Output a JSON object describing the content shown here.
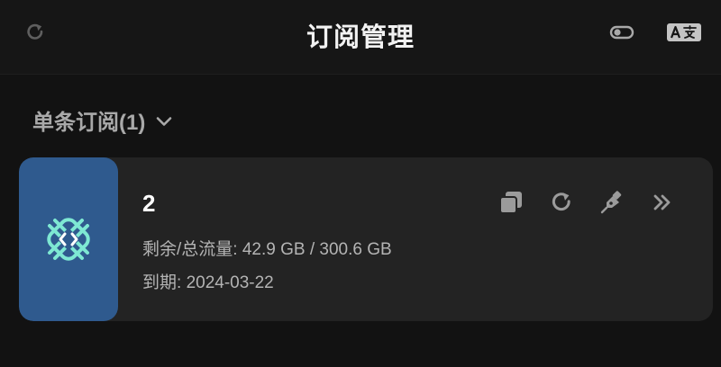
{
  "header": {
    "title": "订阅管理",
    "refresh_icon": "refresh-icon",
    "toggle_icon": "toggle-icon",
    "translate_icon": "translate-icon"
  },
  "group": {
    "title": "单条订阅(1)",
    "expand_icon": "chevron-down-icon"
  },
  "subscriptions": [
    {
      "name": "2",
      "traffic_label": "剩余/总流量:",
      "traffic_value": "42.9 GB / 300.6 GB",
      "expiry_label": "到期:",
      "expiry_value": "2024-03-22",
      "logo_icon": "node-logo-icon",
      "actions": [
        "copy-icon",
        "refresh-icon",
        "edit-pen-icon",
        "more-icon"
      ]
    }
  ],
  "colors": {
    "background": "#121212",
    "header": "#161616",
    "card": "#232323",
    "logo_background": "#2f5a8e",
    "logo_accent": "#7ee8d3",
    "icon": "#9b9b9b"
  }
}
